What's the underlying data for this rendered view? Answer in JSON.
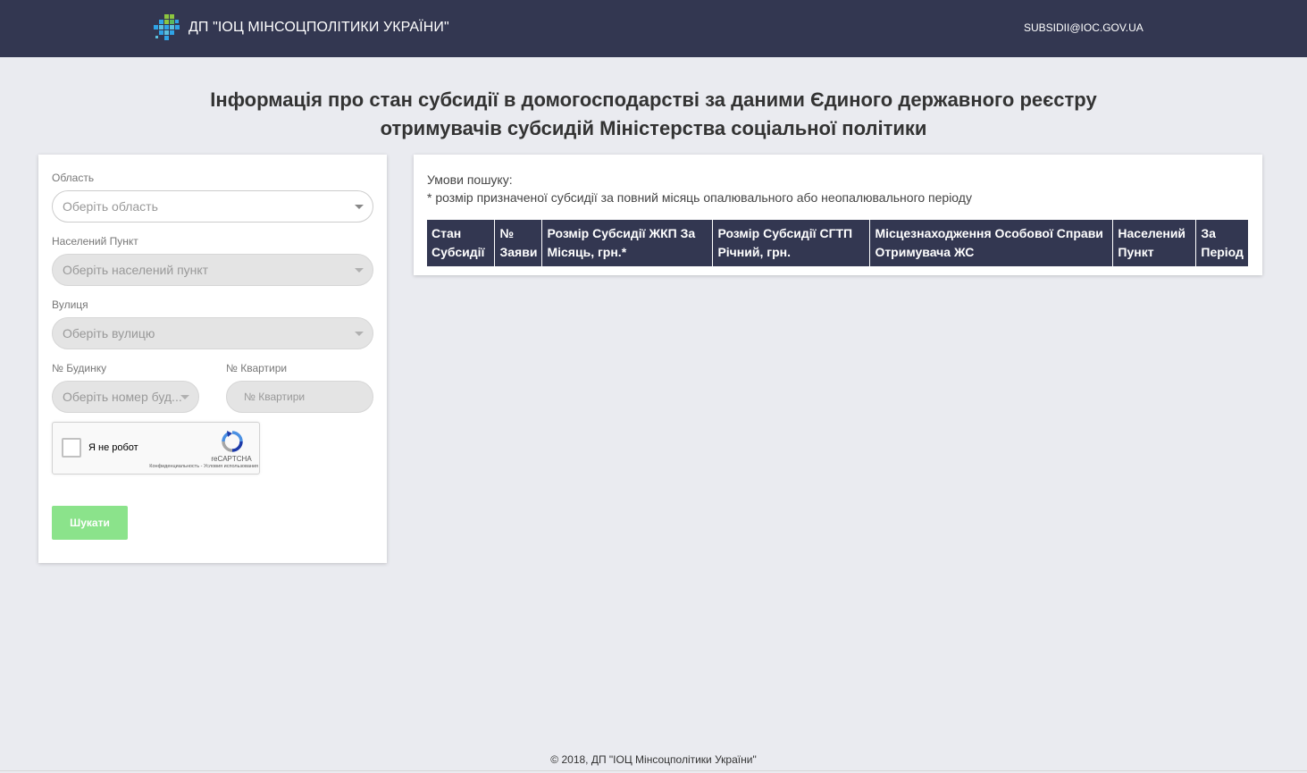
{
  "header": {
    "brand": "ДП \"ІОЦ МІНСОЦПОЛІТИКИ УКРАЇНИ\"",
    "email": "SUBSIDII@IOC.GOV.UA"
  },
  "page": {
    "title_line1": "Інформація про стан субсидії в домогосподарстві за даними Єдиного державного реєстру",
    "title_line2": "отримувачів субсидій Міністерства соціальної політики"
  },
  "form": {
    "region_label": "Область",
    "region_placeholder": "Оберіть область",
    "settlement_label": "Населений Пункт",
    "settlement_placeholder": "Оберіть населений пункт",
    "street_label": "Вулиця",
    "street_placeholder": "Оберіть вулицю",
    "house_label": "№ Будинку",
    "house_placeholder": "Оберіть номер буд...",
    "apartment_label": "№ Квартири",
    "apartment_placeholder": "№ Квартири",
    "captcha_label": "Я не робот",
    "captcha_brand": "reCAPTCHA",
    "captcha_links": "Конфиденциальность - Условия использования",
    "search_button": "Шукати"
  },
  "results": {
    "conditions_title": "Умови пошуку:",
    "conditions_note": "* розмір призначеної субсидії за повний місяць опалювального або неопалювального періоду",
    "columns": [
      "Стан Субсидії",
      "№ Заяви",
      "Розмір Субсидії ЖКП За Місяць, грн.*",
      "Розмір Субсидії СГТП Річний, грн.",
      "Місцезнаходження Особової Справи Отримувача ЖС",
      "Населений Пункт",
      "За Період"
    ]
  },
  "footer": {
    "text": "© 2018, ДП \"ІОЦ Мінсоцполітики України\""
  },
  "colors": {
    "header_bg": "#333751",
    "page_bg": "#eaebf0",
    "button_green": "#8be38b"
  }
}
